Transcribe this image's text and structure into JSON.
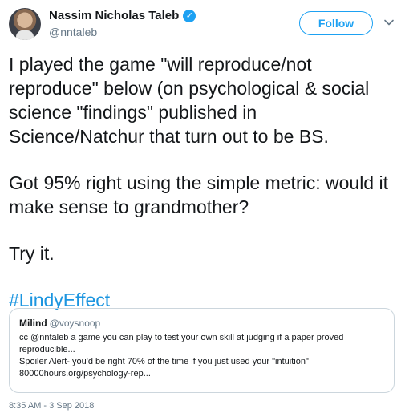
{
  "author": {
    "name": "Nassim Nicholas Taleb",
    "handle": "@nntaleb",
    "verified_icon": "verified-badge-icon",
    "avatar_icon": "profile-photo"
  },
  "header": {
    "follow_label": "Follow",
    "more_icon": "chevron-down-icon"
  },
  "tweet": {
    "paragraphs": [
      "I played the game \"will reproduce/not reproduce\" below (on psychological & social science \"findings\" published in Science/Natchur that turn out to be BS.",
      "Got 95% right using the simple metric: would it make sense to grandmother?",
      "Try it."
    ],
    "hashtag": "#LindyEffect"
  },
  "quote": {
    "name": "Milind",
    "handle": "@voysnoop",
    "lines": [
      "cc @nntaleb a game you can play to test your own skill at judging if a paper proved",
      "reproducible...",
      "Spoiler Alert- you'd be right 70% of the time if you just used your \"intuition\"",
      "80000hours.org/psychology-rep..."
    ]
  },
  "timestamp": "8:35 AM - 3 Sep 2018",
  "colors": {
    "accent": "#1da1f2",
    "link": "#1b95e0",
    "secondary_text": "#657786",
    "border": "#ccd6dd"
  }
}
